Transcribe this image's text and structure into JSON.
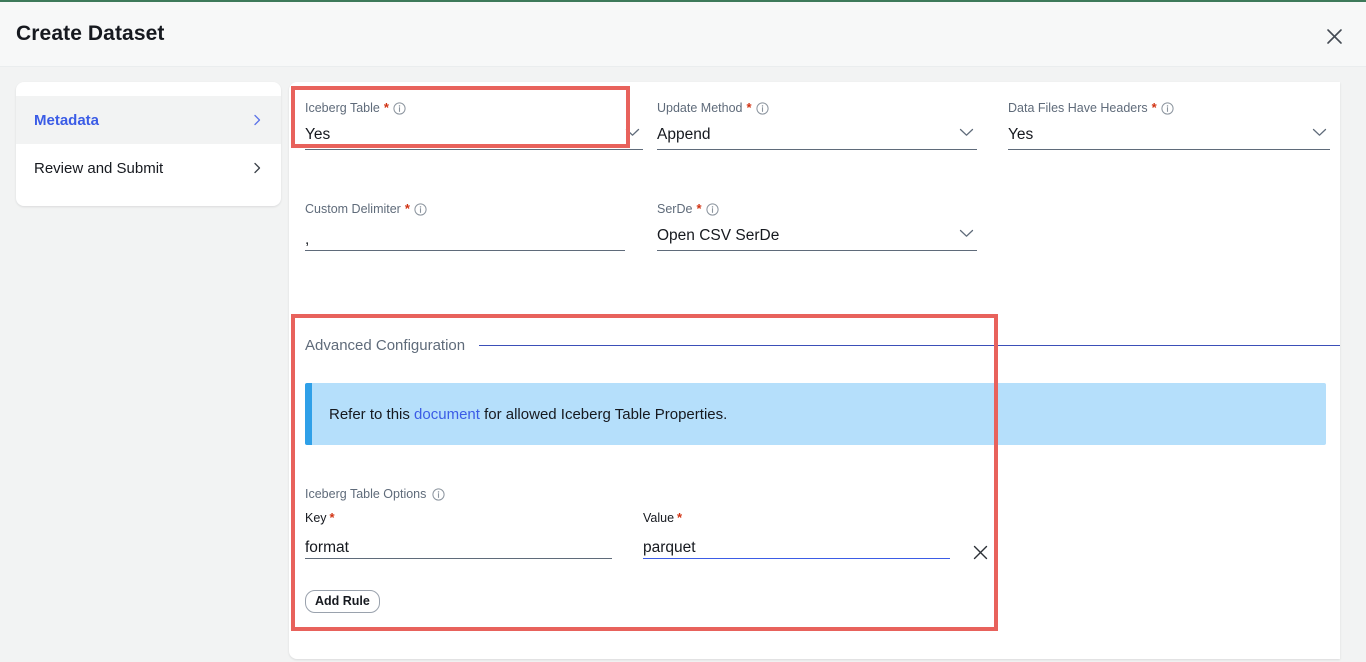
{
  "window": {
    "title": "Create Dataset",
    "close_icon": "close-icon",
    "accent_green": "#3d7a5a"
  },
  "sidebar": {
    "items": [
      {
        "label": "Metadata",
        "active": true,
        "chevron_icon": "chevron-right-icon"
      },
      {
        "label": "Review and Submit",
        "active": false,
        "chevron_icon": "chevron-right-icon"
      }
    ],
    "active_color": "#3b5ce6"
  },
  "form": {
    "fields": [
      {
        "name": "iceberg-table",
        "label": "Iceberg Table",
        "required": "*",
        "info_icon": "info-icon",
        "value": "Yes",
        "control": "select",
        "caret_icon": "chevron-down-icon"
      },
      {
        "name": "update-method",
        "label": "Update Method",
        "required": "*",
        "info_icon": "info-icon",
        "value": "Append",
        "control": "select",
        "caret_icon": "chevron-down-icon"
      },
      {
        "name": "data-files-have-headers",
        "label": "Data Files Have Headers",
        "required": "*",
        "info_icon": "info-icon",
        "value": "Yes",
        "control": "select",
        "caret_icon": "chevron-down-icon"
      },
      {
        "name": "custom-delimiter",
        "label": "Custom Delimiter",
        "required": "*",
        "info_icon": "info-icon",
        "value": ",",
        "control": "text"
      },
      {
        "name": "serde",
        "label": "SerDe",
        "required": "*",
        "info_icon": "info-icon",
        "value": "Open CSV SerDe",
        "control": "select",
        "caret_icon": "chevron-down-icon"
      }
    ]
  },
  "advanced": {
    "section_title": "Advanced Configuration",
    "divider_color": "#3b4fb8",
    "alert": {
      "text_before": "Refer to this ",
      "link_text": "document",
      "text_after": " for allowed Iceberg Table Properties.",
      "background": "#b5dffb",
      "accent": "#2fa0e8"
    },
    "options_label": "Iceberg Table Options",
    "options_info_icon": "info-icon",
    "key_label": "Key",
    "key_required": "*",
    "key_value": "format",
    "value_label": "Value",
    "value_required": "*",
    "value_value": "parquet",
    "remove_icon": "close-icon",
    "add_rule_label": "Add Rule"
  },
  "scrollbar": {
    "name": "vertical-scrollbar"
  },
  "annotations": {
    "color": "#e8625c",
    "boxes": [
      "iceberg-table-field",
      "advanced-configuration-section"
    ]
  }
}
